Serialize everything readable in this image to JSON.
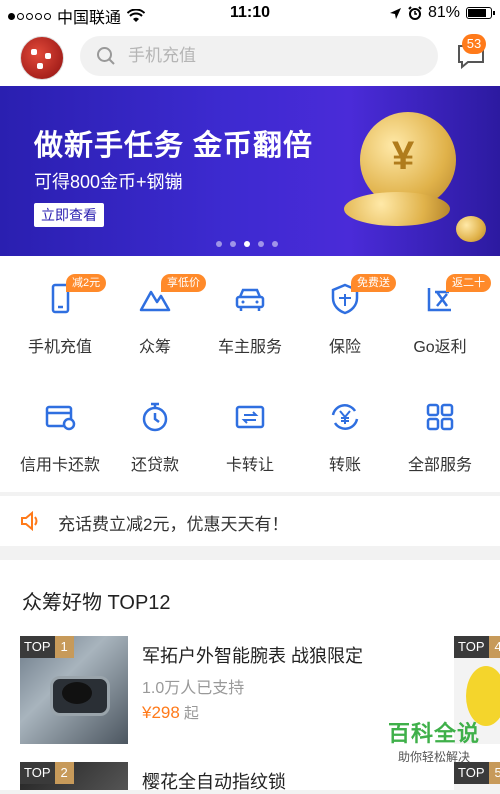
{
  "status": {
    "carrier": "中国联通",
    "time": "11:10",
    "battery": "81%",
    "battery_level": 0.81
  },
  "header": {
    "search_placeholder": "手机充值",
    "message_count": "53"
  },
  "banner": {
    "title": "做新手任务 金币翻倍",
    "subtitle": "可得800金币+钢镚",
    "button": "立即查看",
    "pages": 5,
    "active_page": 3
  },
  "services": [
    {
      "label": "手机充值",
      "tag": "减2元",
      "icon": "phone-icon"
    },
    {
      "label": "众筹",
      "tag": "享低价",
      "icon": "mountain-icon"
    },
    {
      "label": "车主服务",
      "tag": "",
      "icon": "car-icon"
    },
    {
      "label": "保险",
      "tag": "免费送",
      "icon": "shield-icon"
    },
    {
      "label": "Go返利",
      "tag": "返二十",
      "icon": "rebate-icon"
    },
    {
      "label": "信用卡还款",
      "tag": "",
      "icon": "credit-card-icon"
    },
    {
      "label": "还贷款",
      "tag": "",
      "icon": "stopwatch-icon"
    },
    {
      "label": "卡转让",
      "tag": "",
      "icon": "card-transfer-icon"
    },
    {
      "label": "转账",
      "tag": "",
      "icon": "yen-transfer-icon"
    },
    {
      "label": "全部服务",
      "tag": "",
      "icon": "grid-icon"
    }
  ],
  "notice": {
    "text": "充话费立减2元，优惠天天有！"
  },
  "feed": {
    "title": "众筹好物 TOP12",
    "items": [
      {
        "rank_label": "TOP",
        "rank": "1",
        "name": "军拓户外智能腕表 战狼限定",
        "supporters": "1.0万人已支持",
        "price": "¥298",
        "price_suffix": "起"
      },
      {
        "rank_label": "TOP",
        "rank": "2",
        "name": "樱花全自动指纹锁",
        "supporters": "",
        "price": "",
        "price_suffix": ""
      }
    ],
    "peek_ranks": [
      "4",
      "5"
    ]
  },
  "watermark": {
    "title": "百科全说",
    "subtitle": "助你轻松解决"
  },
  "colors": {
    "accent": "#ff7a1a",
    "icon_blue": "#2f6fe0",
    "banner": "#3d2ad0"
  }
}
